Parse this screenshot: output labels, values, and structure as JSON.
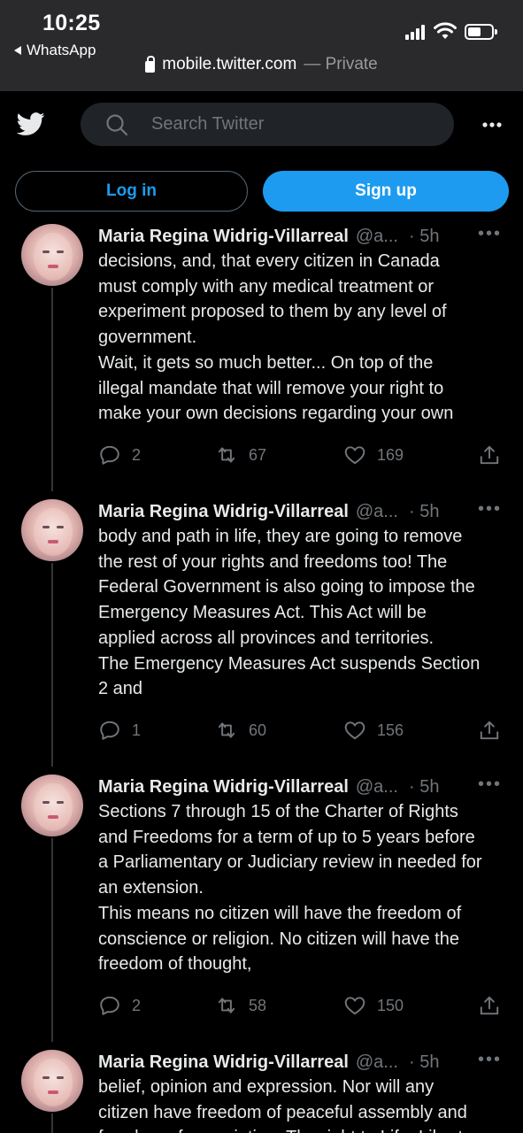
{
  "status_bar": {
    "time": "10:25",
    "back_app": "WhatsApp"
  },
  "browser": {
    "url": "mobile.twitter.com",
    "mode": "— Private"
  },
  "header": {
    "search_placeholder": "Search Twitter",
    "login_label": "Log in",
    "signup_label": "Sign up",
    "accent_color": "#1d9bf0"
  },
  "tweets": [
    {
      "author": "Maria Regina Widrig-Villarreal",
      "handle": "@a...",
      "time": "· 5h",
      "text": "decisions, and, that every citizen in Canada\nmust comply with any medical treatment or\nexperiment proposed to them by any level of\ngovernment.\nWait, it gets so much better... On top of the\nillegal mandate that will remove your right to\nmake your own decisions regarding your own",
      "replies": "2",
      "retweets": "67",
      "likes": "169"
    },
    {
      "author": "Maria Regina Widrig-Villarreal",
      "handle": "@a...",
      "time": "· 5h",
      "text": "body and path in life, they are going to remove\nthe rest of your rights and freedoms too! The\nFederal Government is also going to impose the\nEmergency Measures Act. This Act will be\napplied across all provinces and territories.\nThe Emergency Measures Act suspends Section\n2 and",
      "replies": "1",
      "retweets": "60",
      "likes": "156"
    },
    {
      "author": "Maria Regina Widrig-Villarreal",
      "handle": "@a...",
      "time": "· 5h",
      "text": "Sections 7 through 15 of the Charter of Rights\nand Freedoms for a term of up to 5 years before\na Parliamentary or Judiciary review in needed for\nan extension.\nThis means no citizen will have the freedom of\nconscience or religion. No citizen will have the\nfreedom of thought,",
      "replies": "2",
      "retweets": "58",
      "likes": "150"
    },
    {
      "author": "Maria Regina Widrig-Villarreal",
      "handle": "@a...",
      "time": "· 5h",
      "text": "belief, opinion and expression. Nor will any\ncitizen have freedom of peaceful assembly and\nfreedom of association. The right to Life, Liberty",
      "replies": "",
      "retweets": "",
      "likes": ""
    }
  ]
}
